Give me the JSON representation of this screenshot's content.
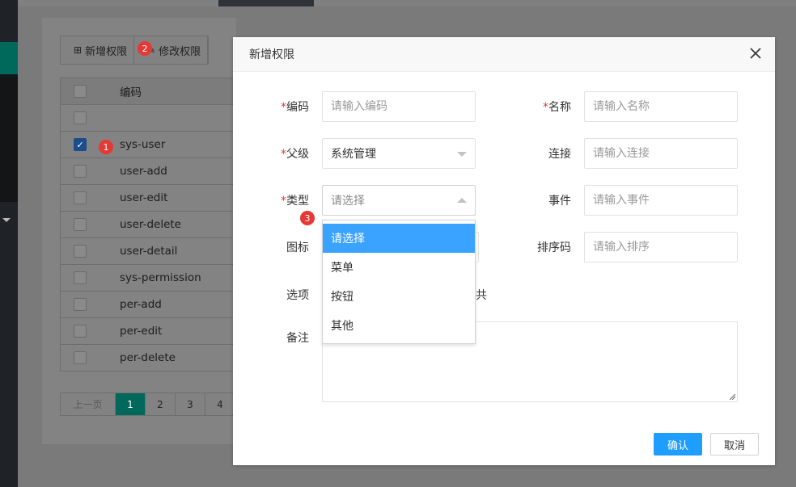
{
  "toolbar": {
    "add_label": "新增权限",
    "edit_label": "修改权限"
  },
  "table": {
    "header": "编码",
    "rows": [
      {
        "code": "",
        "checked": false
      },
      {
        "code": "sys-user",
        "checked": true
      },
      {
        "code": "user-add",
        "checked": false
      },
      {
        "code": "user-edit",
        "checked": false
      },
      {
        "code": "user-delete",
        "checked": false
      },
      {
        "code": "user-detail",
        "checked": false
      },
      {
        "code": "sys-permission",
        "checked": false
      },
      {
        "code": "per-add",
        "checked": false
      },
      {
        "code": "per-edit",
        "checked": false
      },
      {
        "code": "per-delete",
        "checked": false
      }
    ]
  },
  "pager": {
    "prev": "上一页",
    "pages": [
      "1",
      "2",
      "3",
      "4"
    ],
    "current": "1"
  },
  "badges": {
    "b1": "1",
    "b2": "2",
    "b3": "3"
  },
  "dialog": {
    "title": "新增权限",
    "required_mark": "*",
    "fields": {
      "code": {
        "label": "编码",
        "placeholder": "请输入编码"
      },
      "name": {
        "label": "名称",
        "placeholder": "请输入名称"
      },
      "parent": {
        "label": "父级",
        "value": "系统管理"
      },
      "link": {
        "label": "连接",
        "placeholder": "请输入连接"
      },
      "type": {
        "label": "类型",
        "placeholder": "请选择"
      },
      "event": {
        "label": "事件",
        "placeholder": "请输入事件"
      },
      "icon": {
        "label": "图标"
      },
      "sort": {
        "label": "排序码",
        "placeholder": "请输入排序"
      },
      "options": {
        "label": "选项",
        "fragment": "共"
      },
      "remark": {
        "label": "备注"
      }
    },
    "type_dropdown": {
      "options": [
        "请选择",
        "菜单",
        "按钮",
        "其他"
      ],
      "highlighted": "请选择"
    },
    "confirm_label": "确认",
    "cancel_label": "取消"
  },
  "colors": {
    "primary_blue": "#1e9fff",
    "dropdown_highlight": "#3aa3ff",
    "required_red": "#e53935",
    "active_green": "#00695c"
  }
}
